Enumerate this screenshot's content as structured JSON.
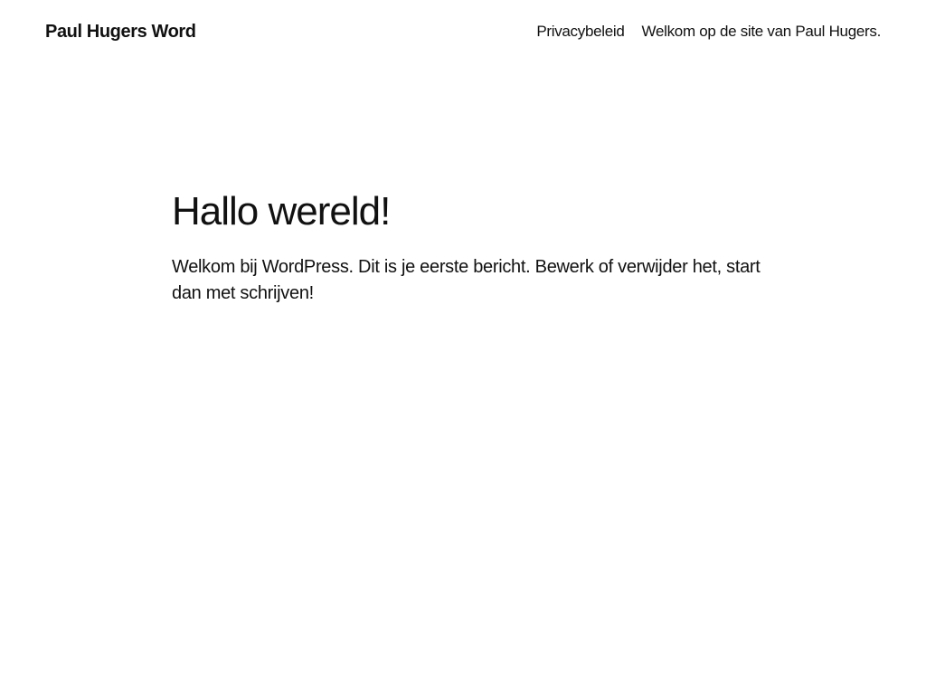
{
  "header": {
    "site_title": "Paul Hugers Word",
    "nav": [
      {
        "label": "Privacybeleid"
      },
      {
        "label": "Welkom op de site van Paul Hugers."
      }
    ]
  },
  "post": {
    "title": "Hallo wereld!",
    "content": "Welkom bij WordPress. Dit is je eerste bericht. Bewerk of verwijder het, start dan met schrijven!"
  },
  "colors": {
    "background": "#ffffff",
    "text": "#111111"
  }
}
